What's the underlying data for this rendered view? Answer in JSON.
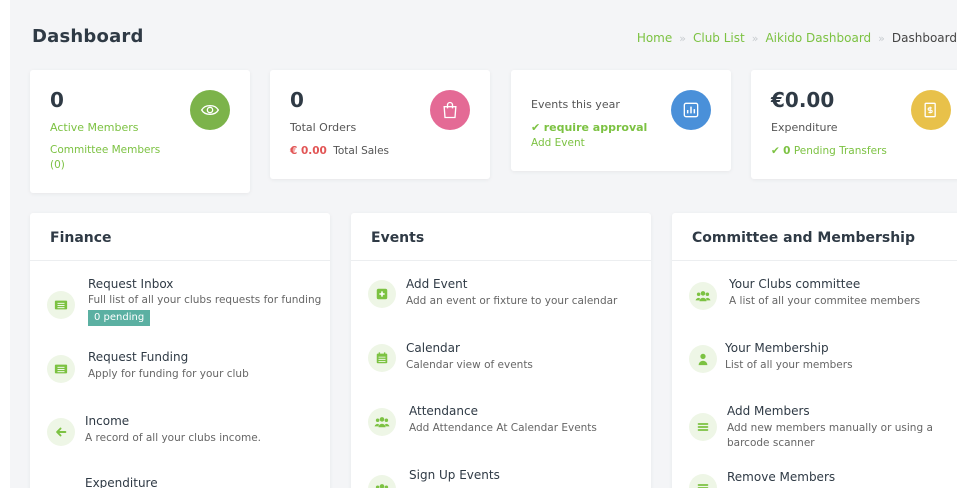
{
  "header": {
    "title": "Dashboard",
    "breadcrumb": [
      "Home",
      "Club List",
      "Aikido Dashboard",
      "Dashboard"
    ],
    "separator": "»"
  },
  "stats": {
    "members": {
      "value": "0",
      "label": "Active Members",
      "sub": "Committee Members",
      "sub2": "(0)"
    },
    "orders": {
      "value": "0",
      "label": "Total Orders",
      "sales_amount": "€ 0.00",
      "sales_label": "Total Sales"
    },
    "events": {
      "label": "Events this year",
      "status": "require approval",
      "link": "Add Event"
    },
    "expenditure": {
      "value": "€0.00",
      "label": "Expenditure",
      "pending_count": "0",
      "pending_label": "Pending Transfers"
    }
  },
  "panels": {
    "finance": {
      "title": "Finance",
      "items": [
        {
          "title": "Request Inbox",
          "desc": "Full list of all your clubs requests for funding",
          "badge": "0 pending"
        },
        {
          "title": "Request Funding",
          "desc": "Apply for funding for your club"
        },
        {
          "title": "Income",
          "desc": "A record of all your clubs income."
        },
        {
          "title": "Expenditure",
          "desc": ""
        }
      ]
    },
    "events": {
      "title": "Events",
      "items": [
        {
          "title": "Add Event",
          "desc": "Add an event or fixture to your calendar"
        },
        {
          "title": "Calendar",
          "desc": "Calendar view of events"
        },
        {
          "title": "Attendance",
          "desc": "Add Attendance At Calendar Events"
        },
        {
          "title": "Sign Up Events",
          "desc": ""
        }
      ]
    },
    "committee": {
      "title": "Committee and Membership",
      "items": [
        {
          "title": "Your Clubs committee",
          "desc": "A list of all your commitee members"
        },
        {
          "title": "Your Membership",
          "desc": "List of all your members"
        },
        {
          "title": "Add Members",
          "desc": "Add new members manually or using a barcode scanner"
        },
        {
          "title": "Remove Members",
          "desc": ""
        }
      ]
    }
  },
  "colors": {
    "accent": "#7cc242",
    "danger": "#e25555",
    "badge": "#5bb0a2"
  }
}
